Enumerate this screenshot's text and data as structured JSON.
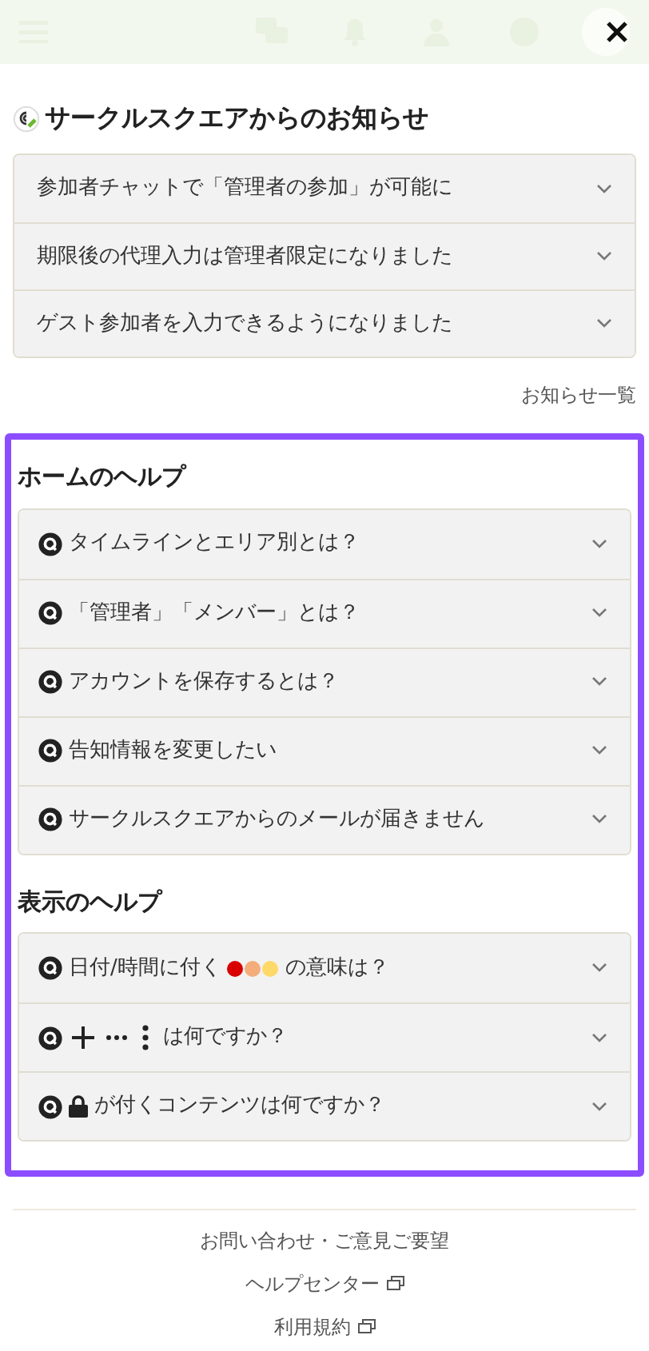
{
  "header": {
    "dimmed": true
  },
  "notices": {
    "title": "サークルスクエアからのお知らせ",
    "items": [
      {
        "text": "参加者チャットで「管理者の参加」が可能に",
        "expanded": false
      },
      {
        "text": "期限後の代理入力は管理者限定になりました",
        "expanded": false
      },
      {
        "text": "ゲスト参加者を入力できるようになりました",
        "expanded": false
      }
    ],
    "more_link": "お知らせ一覧"
  },
  "help": {
    "highlighted": true,
    "sections": [
      {
        "title": "ホームのヘルプ",
        "items": [
          {
            "parts": [
              {
                "kind": "text",
                "text": "タイムラインとエリア別とは？"
              }
            ],
            "expanded": false
          },
          {
            "parts": [
              {
                "kind": "text",
                "text": "「管理者」「メンバー」とは？"
              }
            ],
            "expanded": false
          },
          {
            "parts": [
              {
                "kind": "text",
                "text": "アカウントを保存するとは？"
              }
            ],
            "expanded": false
          },
          {
            "parts": [
              {
                "kind": "text",
                "text": "告知情報を変更したい"
              }
            ],
            "expanded": false
          },
          {
            "parts": [
              {
                "kind": "text",
                "text": "サークルスクエアからのメールが届きません"
              }
            ],
            "expanded": false
          }
        ]
      },
      {
        "title": "表示のヘルプ",
        "items": [
          {
            "parts": [
              {
                "kind": "text",
                "text": "日付/時間に付く"
              },
              {
                "kind": "dots",
                "dots": [
                  {
                    "color": "#d80000"
                  },
                  {
                    "color": "#f4ad7a"
                  },
                  {
                    "color": "#ffd86a"
                  }
                ]
              },
              {
                "kind": "text",
                "text": "の意味は？"
              }
            ],
            "expanded": false
          },
          {
            "parts": [
              {
                "kind": "plus"
              },
              {
                "kind": "ellipsis"
              },
              {
                "kind": "vdots"
              },
              {
                "kind": "text",
                "text": "は何ですか？"
              }
            ],
            "expanded": false
          },
          {
            "parts": [
              {
                "kind": "lock"
              },
              {
                "kind": "text",
                "text": "が付くコンテンツは何ですか？"
              }
            ],
            "expanded": false
          }
        ]
      }
    ]
  },
  "footer": {
    "links": [
      {
        "text": "お問い合わせ・ご意見ご要望",
        "external": false
      },
      {
        "text": "ヘルプセンター",
        "external": true
      },
      {
        "text": "利用規約",
        "external": true
      }
    ]
  }
}
